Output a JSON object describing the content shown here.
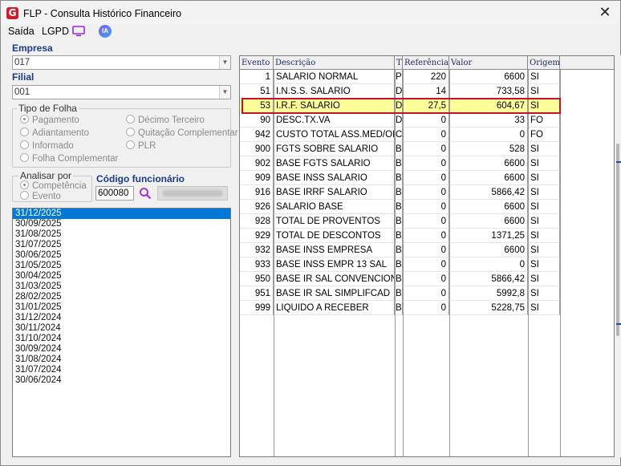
{
  "window": {
    "title": "FLP - Consulta Histórico Financeiro",
    "close_glyph": "✕"
  },
  "menu": {
    "saida": "Saída",
    "lgpd": "LGPD",
    "ia": "IA"
  },
  "empresa": {
    "label": "Empresa",
    "value": "017"
  },
  "filial": {
    "label": "Filial",
    "value": "001"
  },
  "tipo_folha": {
    "title": "Tipo de Folha",
    "options": [
      "Pagamento",
      "Décimo Terceiro",
      "Adiantamento",
      "Quitação Complementar",
      "Informado",
      "PLR",
      "Folha Complementar"
    ],
    "selected": "Pagamento"
  },
  "analisar_por": {
    "title": "Analisar por",
    "options": [
      "Competência",
      "Evento"
    ],
    "selected": "Competência"
  },
  "codigo_funcionario": {
    "label": "Código funcionário",
    "value": "600080"
  },
  "dates": [
    "31/12/2025",
    "30/09/2025",
    "31/08/2025",
    "31/07/2025",
    "30/06/2025",
    "31/05/2025",
    "30/04/2025",
    "31/03/2025",
    "28/02/2025",
    "31/01/2025",
    "31/12/2024",
    "30/11/2024",
    "31/10/2024",
    "30/09/2024",
    "31/08/2024",
    "31/07/2024",
    "30/06/2024"
  ],
  "selected_date": "31/12/2025",
  "grid": {
    "headers": [
      "Evento",
      "Descrição",
      "T",
      "Referência",
      "Valor",
      "Origem"
    ],
    "rows": [
      {
        "evento": "1",
        "descricao": "SALARIO NORMAL",
        "t": "P",
        "referencia": "220",
        "valor": "6600",
        "origem": "SI"
      },
      {
        "evento": "51",
        "descricao": "I.N.S.S. SALARIO",
        "t": "D",
        "referencia": "14",
        "valor": "733,58",
        "origem": "SI"
      },
      {
        "evento": "53",
        "descricao": "I.R.F. SALARIO",
        "t": "D",
        "referencia": "27,5",
        "valor": "604,67",
        "origem": "SI",
        "highlighted": true
      },
      {
        "evento": "90",
        "descricao": "DESC.TX.VA",
        "t": "D",
        "referencia": "0",
        "valor": "33",
        "origem": "FO"
      },
      {
        "evento": "942",
        "descricao": "CUSTO TOTAL ASS.MED/OD",
        "t": "C",
        "referencia": "0",
        "valor": "0",
        "origem": "FO"
      },
      {
        "evento": "900",
        "descricao": "FGTS SOBRE SALARIO",
        "t": "B",
        "referencia": "0",
        "valor": "528",
        "origem": "SI"
      },
      {
        "evento": "902",
        "descricao": "BASE FGTS SALARIO",
        "t": "B",
        "referencia": "0",
        "valor": "6600",
        "origem": "SI"
      },
      {
        "evento": "909",
        "descricao": "BASE INSS SALARIO",
        "t": "B",
        "referencia": "0",
        "valor": "6600",
        "origem": "SI"
      },
      {
        "evento": "916",
        "descricao": "BASE IRRF SALARIO",
        "t": "B",
        "referencia": "0",
        "valor": "5866,42",
        "origem": "SI"
      },
      {
        "evento": "926",
        "descricao": "SALARIO BASE",
        "t": "B",
        "referencia": "0",
        "valor": "6600",
        "origem": "SI"
      },
      {
        "evento": "928",
        "descricao": "TOTAL DE PROVENTOS",
        "t": "B",
        "referencia": "0",
        "valor": "6600",
        "origem": "SI"
      },
      {
        "evento": "929",
        "descricao": "TOTAL DE DESCONTOS",
        "t": "B",
        "referencia": "0",
        "valor": "1371,25",
        "origem": "SI"
      },
      {
        "evento": "932",
        "descricao": "BASE INSS EMPRESA",
        "t": "B",
        "referencia": "0",
        "valor": "6600",
        "origem": "SI"
      },
      {
        "evento": "933",
        "descricao": "BASE INSS EMPR 13 SAL",
        "t": "B",
        "referencia": "0",
        "valor": "0",
        "origem": "SI"
      },
      {
        "evento": "950",
        "descricao": "BASE IR SAL CONVENCION",
        "t": "B",
        "referencia": "0",
        "valor": "5866,42",
        "origem": "SI"
      },
      {
        "evento": "951",
        "descricao": "BASE IR SAL SIMPLIFCAD",
        "t": "B",
        "referencia": "0",
        "valor": "5992,8",
        "origem": "SI"
      },
      {
        "evento": "999",
        "descricao": "LIQUIDO A RECEBER",
        "t": "B",
        "referencia": "0",
        "valor": "5228,75",
        "origem": "SI"
      }
    ]
  },
  "colors": {
    "accent_blue": "#0078d7",
    "highlight_fill": "#ffff99",
    "highlight_border": "#c8102e",
    "label_blue": "#1a3a8a"
  }
}
